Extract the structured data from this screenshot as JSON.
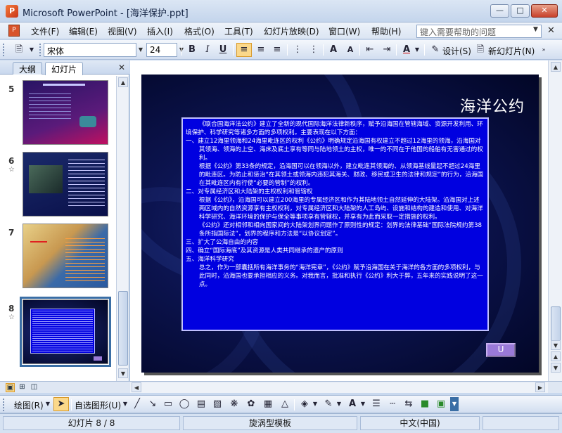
{
  "window": {
    "title": "Microsoft PowerPoint - [海洋保护.ppt]",
    "app_icon": "P",
    "controls": [
      "minimize-icon",
      "maximize-icon",
      "close-icon"
    ]
  },
  "menubar": {
    "items": [
      "文件(F)",
      "编辑(E)",
      "视图(V)",
      "插入(I)",
      "格式(O)",
      "工具(T)",
      "幻灯片放映(D)",
      "窗口(W)",
      "帮助(H)"
    ],
    "help_placeholder": "键入需要帮助的问题"
  },
  "toolbar": {
    "font_name": "宋体",
    "font_size": "24",
    "bold": "B",
    "italic": "I",
    "underline": "U",
    "design_label": "设计(S)",
    "new_slide_label": "新幻灯片(N)",
    "font_color": "A"
  },
  "left_panel": {
    "tabs": [
      "大纲",
      "幻灯片"
    ],
    "active_tab": "幻灯片",
    "slides": [
      {
        "number": "5",
        "has_anim": false
      },
      {
        "number": "6",
        "has_anim": true
      },
      {
        "number": "7",
        "has_anim": false
      },
      {
        "number": "8",
        "has_anim": true,
        "selected": true
      }
    ]
  },
  "slide": {
    "title": "海洋公约",
    "paragraphs": [
      {
        "style": "indent",
        "text": "《联合国海洋法公约》建立了全新的现代国际海洋法律新秩序，赋予沿海国在管辖海域、资源开发利用、环境保护、科学研究等诸多方面的多项权利。主要表现在以下方面："
      },
      {
        "style": "hang",
        "text": "一、建立12海里领海和24海里毗连区的权利《公约》明确规定沿海国有权建立不超过12海里的领海，沿海国对其领海、领海的上空、海床及底土享有等同与陆地领土的主权，唯一的不同在于他国的船舶有无害通过的权利。"
      },
      {
        "style": "sub",
        "text": "根据《公约》第33条的规定，沿海国可以在领海以外，建立毗连其领海的、从领海基线量起不超过24海里的毗连区。为防止和惩治“在其领土或领海内违犯其海关、财政、移民或卫生的法律和规定”的行为，沿海国在其毗连区内有行使“必要的管制”的权利。"
      },
      {
        "style": "hang",
        "text": "二、对专属经济区和大陆架的主权权利和管辖权"
      },
      {
        "style": "sub",
        "text": "根据《公约》，沿海国可以建立200海里的专属经济区和作为其陆地领土自然延伸的大陆架。沿海国对上述两区域内的自然资源享有主权权利，对专属经济区和大陆架的人工岛屿、设施和结构的建造和使用、对海洋科学研究、海洋环境的保护与保全等事项享有管辖权，并享有为此而采取一定措施的权利。"
      },
      {
        "style": "sub",
        "text": "《公约》还对相邻和相向国家间的大陆架划界问题作了原则性的规定：划界的法律基础“国际法院规约第38条所指国际法”，划界的程序和方法是“以协议划定”。"
      },
      {
        "style": "hang",
        "text": "三、扩大了公海自由的内容"
      },
      {
        "style": "hang",
        "text": "四、确立“国际海底”及其资源是人类共同继承的遗产的原则"
      },
      {
        "style": "hang",
        "text": "五、海洋科学研究"
      },
      {
        "style": "sub",
        "text": "总之，作为一部囊括所有海洋事务的“海洋宪章”，《公约》赋予沿海国在关于海洋的各方面的多项权利，与此同时，沿海国也要承担相应的义务。对我而言，批准和执行《公约》利大于弊，五年来的实践说明了这一点。"
      }
    ],
    "action_button": "U"
  },
  "drawbar": {
    "draw_label": "绘图(R)",
    "autoshape_label": "自选图形(U)"
  },
  "statusbar": {
    "slide_info": "幻灯片 8 / 8",
    "template": "旋涡型模板",
    "language": "中文(中国)"
  },
  "colors": {
    "content_box_bg": "#0000e0",
    "slide_bg": "#0c1450",
    "ui_accent": "#3a6ea5"
  }
}
